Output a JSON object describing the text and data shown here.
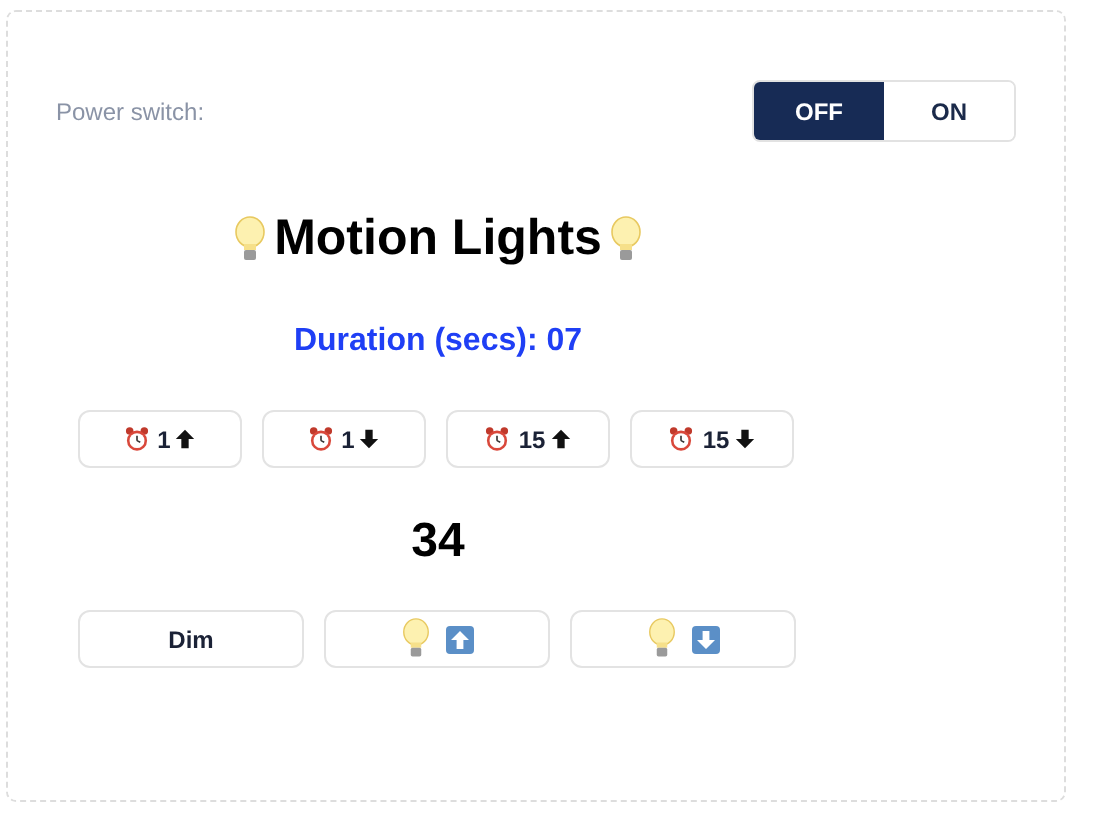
{
  "power_switch": {
    "label": "Power switch:",
    "options": [
      {
        "label": "OFF",
        "selected": true
      },
      {
        "label": "ON",
        "selected": false
      }
    ]
  },
  "title": "Motion Lights",
  "duration": "Duration (secs): 07",
  "duration_buttons": [
    {
      "amount": "1",
      "kind": "up"
    },
    {
      "amount": "1",
      "kind": "down"
    },
    {
      "amount": "15",
      "kind": "up"
    },
    {
      "amount": "15",
      "kind": "down"
    }
  ],
  "brightness": "34",
  "brightness_buttons": [
    {
      "kind": "text",
      "label": "Dim"
    },
    {
      "kind": "up"
    },
    {
      "kind": "down"
    }
  ]
}
